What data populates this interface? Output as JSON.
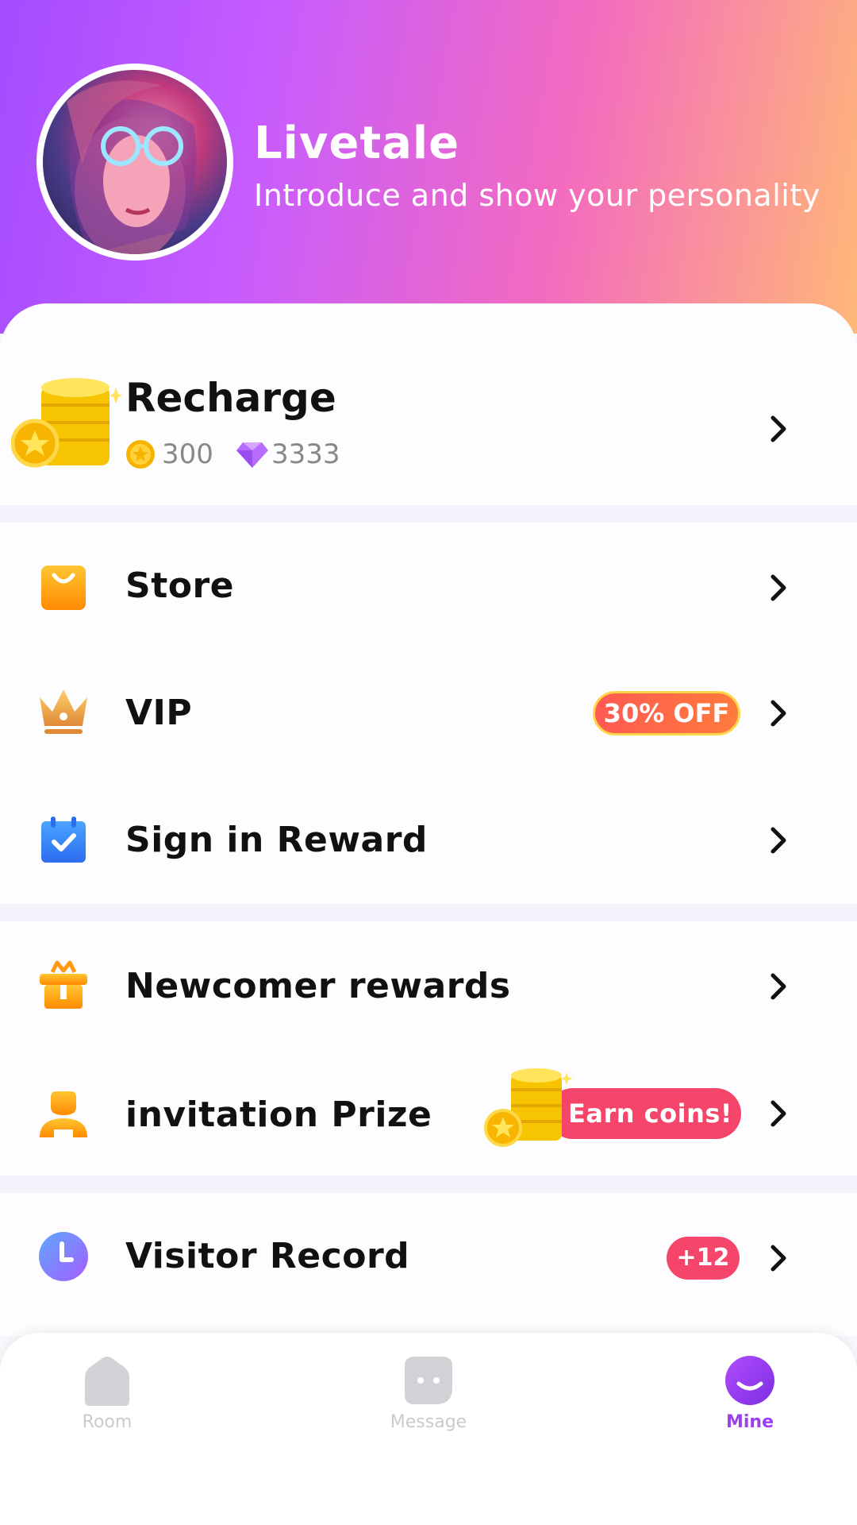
{
  "profile": {
    "name": "Livetale",
    "bio": "Introduce and show your personality"
  },
  "recharge": {
    "title": "Recharge",
    "coins": "300",
    "gems": "3333"
  },
  "menu": [
    {
      "label": "Store",
      "icon": "shopping-bag-icon"
    },
    {
      "label": "VIP",
      "icon": "crown-icon",
      "badge": "30% OFF"
    },
    {
      "label": "Sign in Reward",
      "icon": "calendar-check-icon"
    },
    {
      "label": "Newcomer rewards",
      "icon": "gift-icon"
    },
    {
      "label": "invitation Prize",
      "icon": "person-icon",
      "badge": "Earn coins!"
    },
    {
      "label": "Visitor Record",
      "icon": "clock-icon",
      "badge": "+12"
    }
  ],
  "tabs": [
    {
      "label": "Room",
      "icon": "home-icon",
      "active": false
    },
    {
      "label": "Message",
      "icon": "message-icon",
      "active": false
    },
    {
      "label": "Mine",
      "icon": "smile-icon",
      "active": true
    }
  ],
  "colors": {
    "accent": "#9b3ff0",
    "badge_red": "#f5456a",
    "header_start": "#a44cff",
    "header_end": "#ffb877"
  }
}
